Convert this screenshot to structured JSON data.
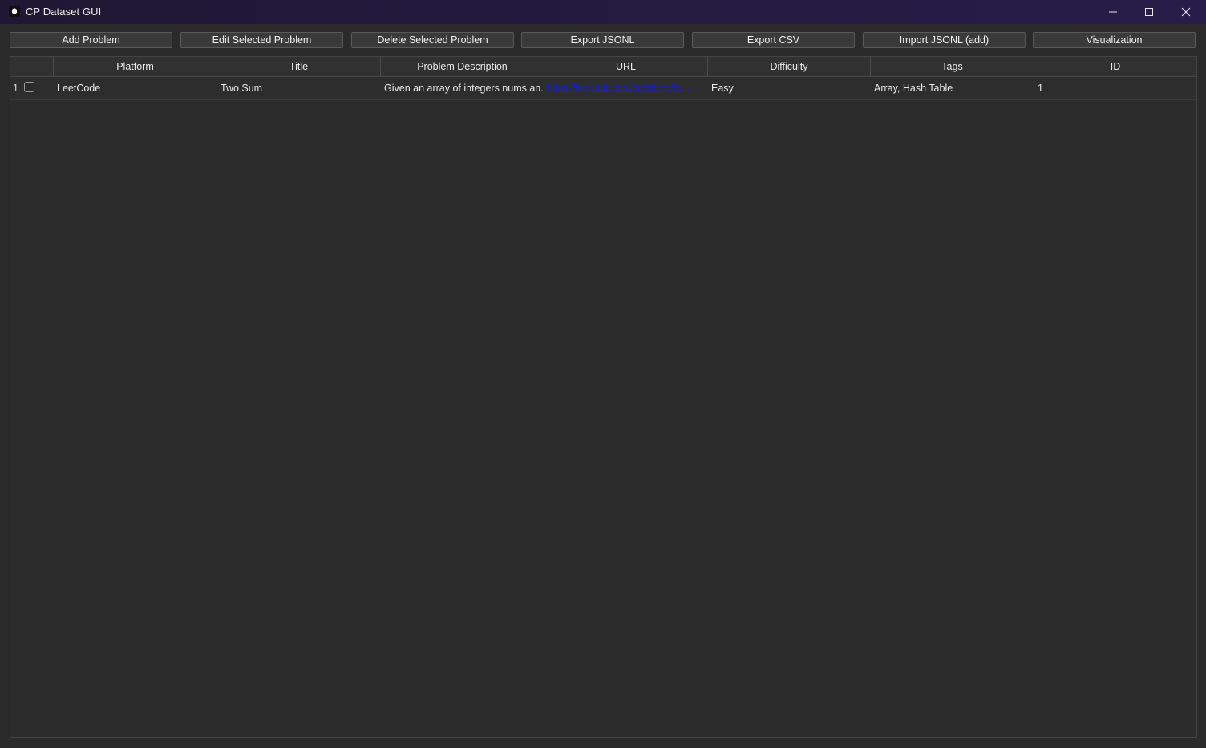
{
  "window": {
    "title": "CP Dataset GUI"
  },
  "toolbar": {
    "buttons": [
      {
        "label": "Add Problem"
      },
      {
        "label": "Edit Selected Problem"
      },
      {
        "label": "Delete Selected Problem"
      },
      {
        "label": "Export JSONL"
      },
      {
        "label": "Export CSV"
      },
      {
        "label": "Import JSONL (add)"
      },
      {
        "label": "Visualization"
      }
    ]
  },
  "table": {
    "columns": [
      "Platform",
      "Title",
      "Problem Description",
      "URL",
      "Difficulty",
      "Tags",
      "ID"
    ],
    "rows": [
      {
        "row_number": "1",
        "checked": false,
        "platform": "LeetCode",
        "title": "Two Sum",
        "description": "Given an array of integers nums an...",
        "url": "https://leetcode.com/problems/tw...",
        "difficulty": "Easy",
        "tags": "Array, Hash Table",
        "id": "1"
      }
    ]
  },
  "colors": {
    "titlebar": "#221a3d",
    "background": "#2a2a2a",
    "link": "#1a1ad8"
  }
}
